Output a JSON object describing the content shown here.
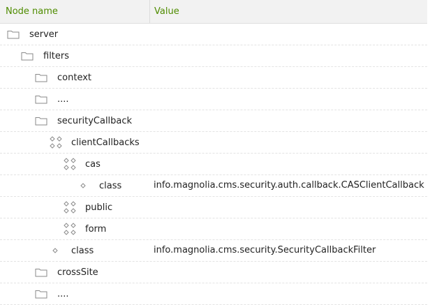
{
  "header": {
    "node_name": "Node name",
    "value": "Value"
  },
  "rows": [
    {
      "label": "server",
      "value": "",
      "icon": "folder-icon",
      "level": 0
    },
    {
      "label": "filters",
      "value": "",
      "icon": "folder-icon",
      "level": 1
    },
    {
      "label": "context",
      "value": "",
      "icon": "folder-icon",
      "level": 2
    },
    {
      "label": "....",
      "value": "",
      "icon": "folder-icon",
      "level": 2
    },
    {
      "label": "securityCallback",
      "value": "",
      "icon": "folder-icon",
      "level": 2
    },
    {
      "label": "clientCallbacks",
      "value": "",
      "icon": "content-node-icon",
      "level": 3
    },
    {
      "label": "cas",
      "value": "",
      "icon": "content-node-icon",
      "level": 4
    },
    {
      "label": "class",
      "value": "info.magnolia.cms.security.auth.callback.CASClientCallback",
      "icon": "property-icon",
      "level": 5
    },
    {
      "label": "public",
      "value": "",
      "icon": "content-node-icon",
      "level": 4
    },
    {
      "label": "form",
      "value": "",
      "icon": "content-node-icon",
      "level": 4
    },
    {
      "label": "class",
      "value": "info.magnolia.cms.security.SecurityCallbackFilter",
      "icon": "property-icon",
      "level": 3
    },
    {
      "label": "crossSite",
      "value": "",
      "icon": "folder-icon",
      "level": 2
    },
    {
      "label": "....",
      "value": "",
      "icon": "folder-icon",
      "level": 2
    }
  ],
  "colors": {
    "header_text": "#4f8c00",
    "header_bg": "#f2f2f2",
    "icon_stroke": "#8a8a8a"
  }
}
